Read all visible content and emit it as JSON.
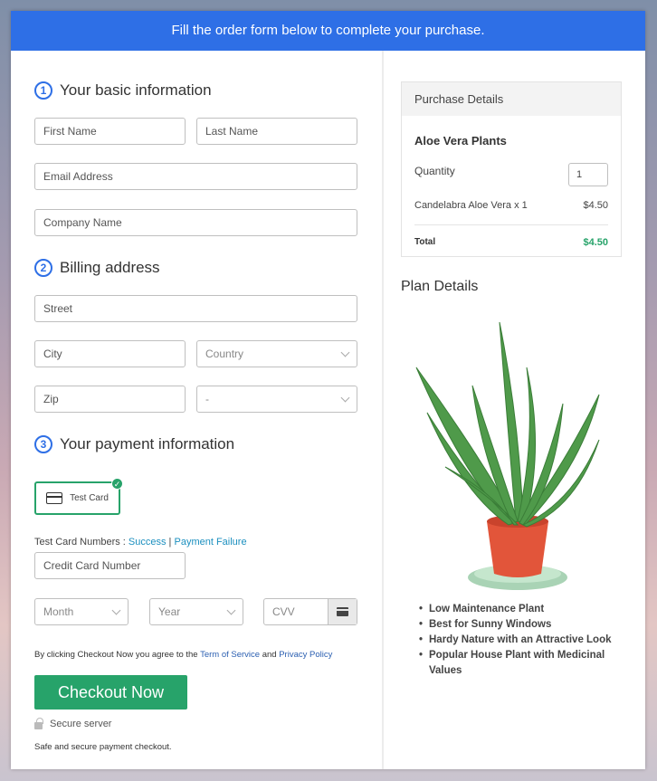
{
  "banner": {
    "text": "Fill the order form below to complete your purchase."
  },
  "basic": {
    "step": "1",
    "title": "Your basic information",
    "first_name": "First Name",
    "last_name": "Last Name",
    "email": "Email Address",
    "company": "Company Name"
  },
  "billing": {
    "step": "2",
    "title": "Billing address",
    "street": "Street",
    "city": "City",
    "country": "Country",
    "zip": "Zip",
    "state": "-"
  },
  "payment": {
    "step": "3",
    "title": "Your payment information",
    "test_card_label": "Test Card",
    "test_numbers_label": "Test Card Numbers : ",
    "success_link": "Success",
    "separator": " | ",
    "failure_link": "Payment Failure",
    "card_number": "Credit Card Number",
    "month": "Month",
    "year": "Year",
    "cvv": "CVV"
  },
  "agreement": {
    "prefix": "By clicking Checkout Now you agree to the ",
    "terms": "Term of Service",
    "and": " and ",
    "privacy": "Privacy Policy"
  },
  "checkout": {
    "button": "Checkout Now",
    "secure": "Secure server",
    "note": "Safe and secure payment checkout."
  },
  "purchase": {
    "heading": "Purchase Details",
    "product": "Aloe Vera Plants",
    "quantity_label": "Quantity",
    "quantity_value": "1",
    "item": "Candelabra Aloe Vera x 1",
    "item_price": "$4.50",
    "total_label": "Total",
    "total_value": "$4.50"
  },
  "plan": {
    "title": "Plan Details",
    "features": [
      "Low Maintenance Plant",
      "Best for Sunny Windows",
      "Hardy Nature with an Attractive Look",
      "Popular House Plant with Medicinal Values"
    ]
  },
  "colors": {
    "brand_blue": "#2e6fe6",
    "checkout_green": "#27a36a",
    "link_blue": "#1b8fbf"
  }
}
